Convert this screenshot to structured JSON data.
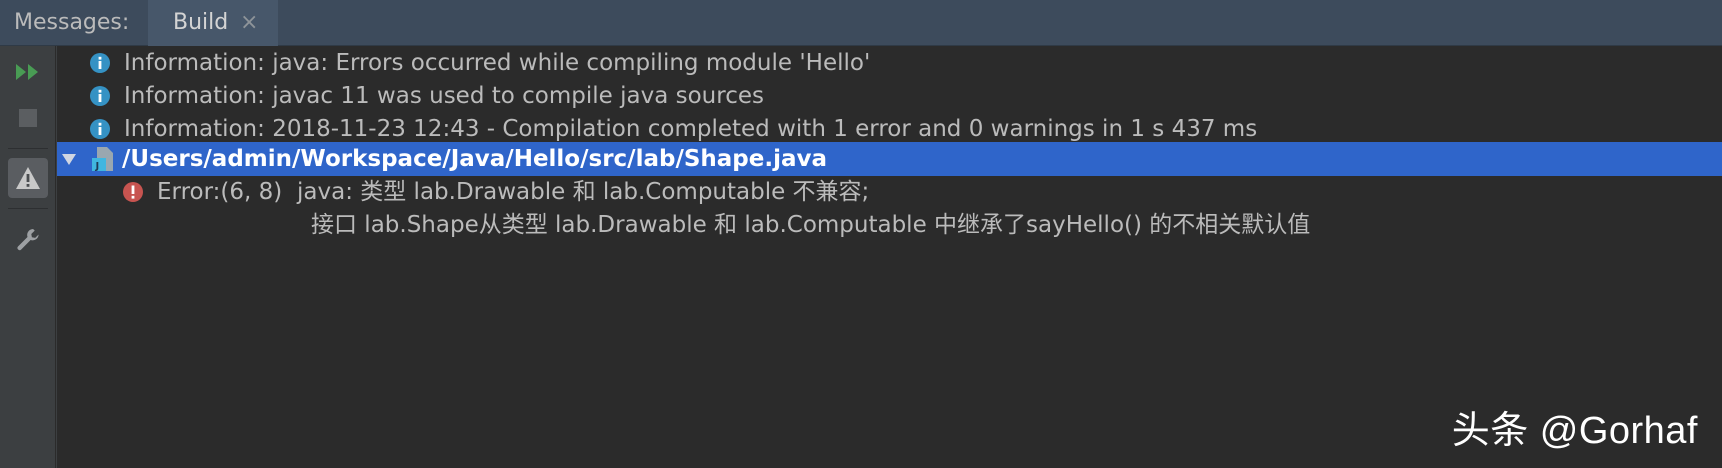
{
  "tabs": {
    "messages_label": "Messages:",
    "build_label": "Build",
    "close_glyph": "×"
  },
  "toolbar": {
    "rerun_icon": "rerun-icon",
    "stop_icon": "stop-icon",
    "warning_filter_icon": "warning-icon",
    "settings_icon": "wrench-icon"
  },
  "messages": [
    {
      "type": "info",
      "text": "Information: java: Errors occurred while compiling module 'Hello'"
    },
    {
      "type": "info",
      "text": "Information: javac 11 was used to compile java sources"
    },
    {
      "type": "info",
      "text": "Information: 2018-11-23 12:43 - Compilation completed with 1 error and 0 warnings in 1 s 437 ms"
    }
  ],
  "file_node": {
    "path": "/Users/admin/Workspace/Java/Hello/src/lab/Shape.java",
    "expanded": true
  },
  "error": {
    "location": "Error:(6, 8)",
    "line1": "java: 类型 lab.Drawable 和 lab.Computable 不兼容;",
    "line2": "接口 lab.Shape从类型 lab.Drawable 和 lab.Computable 中继承了sayHello() 的不相关默认值"
  },
  "watermark": "头条 @Gorhaf",
  "colors": {
    "info": "#3592c4",
    "error": "#c75450",
    "selection": "#2f65ca",
    "rerun": "#499c54"
  }
}
